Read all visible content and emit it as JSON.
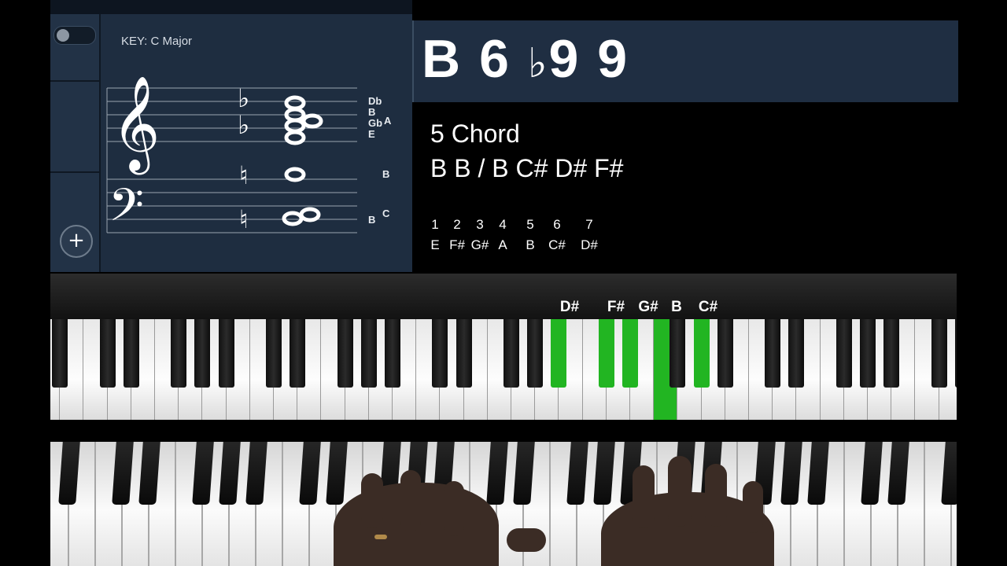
{
  "notation": {
    "key_label": "KEY: C Major",
    "right_labels": [
      "Db",
      "B",
      "Gb",
      "E"
    ],
    "right_label_a": "A",
    "mid_label": "B",
    "low_label_b": "B",
    "low_label_c": "C",
    "add_button": "+"
  },
  "chord_symbol": {
    "root": "B",
    "six": "6",
    "flat": "♭",
    "nine": "9",
    "nine2": "9"
  },
  "info": {
    "title": "5 Chord",
    "notes": "B B / B C# D# F#",
    "scale": [
      {
        "degree": "1",
        "note": "E"
      },
      {
        "degree": "2",
        "note": "F#"
      },
      {
        "degree": "3",
        "note": "G#"
      },
      {
        "degree": "4",
        "note": "A"
      },
      {
        "degree": "5",
        "note": "B"
      },
      {
        "degree": "6",
        "note": "C#"
      },
      {
        "degree": "7",
        "note": "D#"
      }
    ]
  },
  "keyboard": {
    "active_labels": [
      "D#",
      "F#",
      "G#",
      "B",
      "C#"
    ],
    "highlight_color": "#22b522"
  }
}
